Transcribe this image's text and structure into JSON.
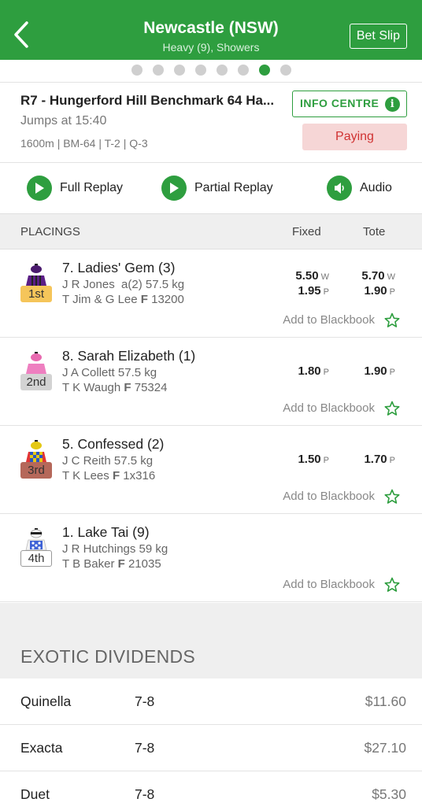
{
  "header": {
    "venue": "Newcastle (NSW)",
    "subtitle": "Heavy (9), Showers",
    "betslip_label": "Bet Slip",
    "back_icon": "chevron-left-icon"
  },
  "pager": {
    "total": 8,
    "active_index": 6
  },
  "race": {
    "title": "R7 - Hungerford Hill Benchmark 64 Ha...",
    "jumps": "Jumps at 15:40",
    "meta": "1600m | BM-64 | T-2 | Q-3",
    "info_label": "INFO CENTRE",
    "info_icon": "i",
    "status": "Paying",
    "status_color": "#d03232"
  },
  "replay": {
    "full": "Full Replay",
    "partial": "Partial Replay",
    "audio": "Audio"
  },
  "placings_header": {
    "title": "PLACINGS",
    "fixed": "Fixed",
    "tote": "Tote"
  },
  "runners": [
    {
      "place": "1st",
      "name": "7. Ladies' Gem (3)",
      "jockey_prefix": "J",
      "jockey": "R Jones",
      "claim": "a(2)",
      "weight": "57.5 kg",
      "trainer_prefix": "T",
      "trainer": "Jim & G Lee",
      "form_prefix": "F",
      "form": "13200",
      "fixed_win": "5.50",
      "fixed_win_tag": "W",
      "fixed_place": "1.95",
      "fixed_place_tag": "P",
      "tote_win": "5.70",
      "tote_win_tag": "W",
      "tote_place": "1.90",
      "tote_place_tag": "P",
      "blackbook": "Add to Blackbook",
      "badge_color": "#f5c55a"
    },
    {
      "place": "2nd",
      "name": "8. Sarah Elizabeth (1)",
      "jockey_prefix": "J",
      "jockey": "A Collett",
      "claim": "",
      "weight": "57.5 kg",
      "trainer_prefix": "T",
      "trainer": "K Waugh",
      "form_prefix": "F",
      "form": "75324",
      "fixed_place": "1.80",
      "fixed_place_tag": "P",
      "tote_place": "1.90",
      "tote_place_tag": "P",
      "blackbook": "Add to Blackbook",
      "badge_color": "#d3d3d3"
    },
    {
      "place": "3rd",
      "name": "5. Confessed (2)",
      "jockey_prefix": "J",
      "jockey": "C Reith",
      "claim": "",
      "weight": "57.5 kg",
      "trainer_prefix": "T",
      "trainer": "K Lees",
      "form_prefix": "F",
      "form": "1x316",
      "fixed_place": "1.50",
      "fixed_place_tag": "P",
      "tote_place": "1.70",
      "tote_place_tag": "P",
      "blackbook": "Add to Blackbook",
      "badge_color": "#b5685a"
    },
    {
      "place": "4th",
      "name": "1. Lake Tai (9)",
      "jockey_prefix": "J",
      "jockey": "R Hutchings",
      "claim": "",
      "weight": "59 kg",
      "trainer_prefix": "T",
      "trainer": "B Baker",
      "form_prefix": "F",
      "form": "21035",
      "blackbook": "Add to Blackbook",
      "badge_color": "#ffffff"
    }
  ],
  "exotic": {
    "title": "EXOTIC DIVIDENDS",
    "rows": [
      {
        "name": "Quinella",
        "combination": "7-8",
        "dividend": "$11.60"
      },
      {
        "name": "Exacta",
        "combination": "7-8",
        "dividend": "$27.10"
      },
      {
        "name": "Duet",
        "combination": "7-8",
        "dividend": "$5.30"
      }
    ]
  },
  "colors": {
    "brand": "#2e9e3f",
    "paying_bg": "#f6d6d6"
  }
}
